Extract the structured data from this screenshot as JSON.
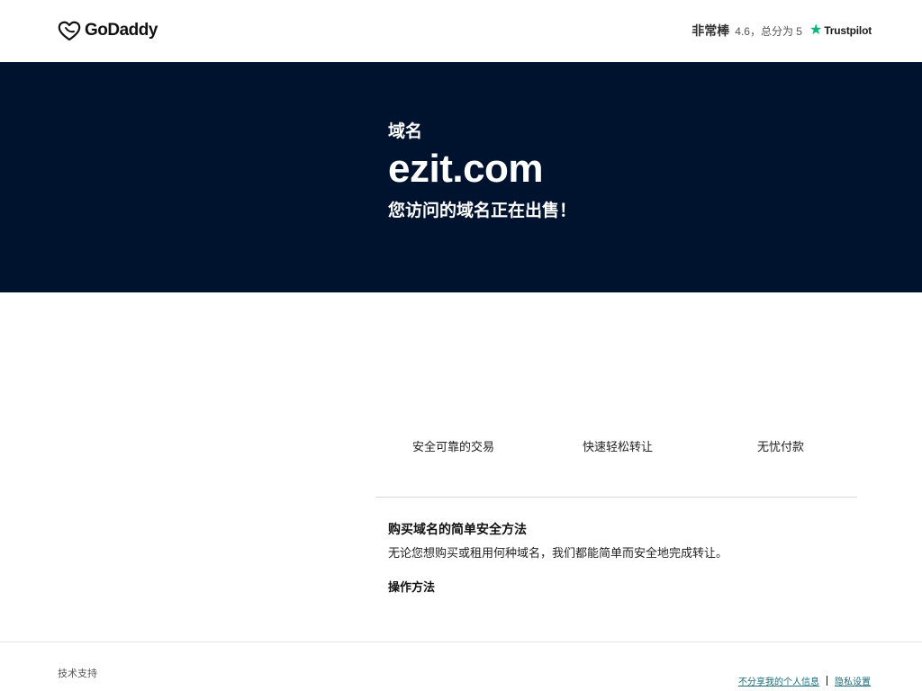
{
  "header": {
    "logo_text": "GoDaddy",
    "rating_word": "非常棒",
    "rating_score": "4.6，总分为 5",
    "trustpilot_star": "★",
    "trustpilot_name": "Trustpilot"
  },
  "hero": {
    "kicker": "域名",
    "domain": "ezit.com",
    "subtitle": "您访问的域名正在出售！"
  },
  "features": [
    {
      "label": "安全可靠的交易"
    },
    {
      "label": "快速轻松转让"
    },
    {
      "label": "无忧付款"
    }
  ],
  "info": {
    "title": "购买域名的简单安全方法",
    "body": "无论您想购买或租用何种域名，我们都能简单而安全地完成转让。",
    "howto_link": "操作方法"
  },
  "footer": {
    "support": "技术支持",
    "privacy_optout": "不分享我的个人信息",
    "privacy_settings": "隐私设置"
  },
  "colors": {
    "hero_bg": "#00132e",
    "trustpilot_green": "#00b67a",
    "footer_link": "#1b6f7a"
  }
}
